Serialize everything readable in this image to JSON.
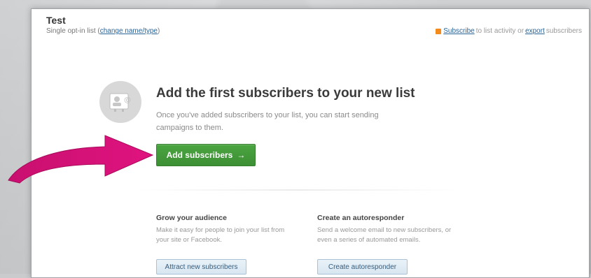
{
  "list": {
    "title": "Test",
    "type_prefix": "Single opt-in list (",
    "change_link": "change name/type",
    "type_suffix": ")"
  },
  "subscribe_bar": {
    "icon": "rss-icon",
    "subscribe_link": "Subscribe",
    "middle_text": " to list activity or ",
    "export_link": "export",
    "end_text": " subscribers"
  },
  "empty_state": {
    "icon": "address-card-icon",
    "headline": "Add the first subscribers to your new list",
    "description": "Once you've added subscribers to your list, you can start sending campaigns to them.",
    "button_label": "Add subscribers",
    "button_arrow": "→"
  },
  "grow": {
    "title": "Grow your audience",
    "description": "Make it easy for people to join your list from your site or Facebook.",
    "button_label": "Attract new subscribers"
  },
  "autoresponder": {
    "title": "Create an autoresponder",
    "description": "Send a welcome email to new subscribers, or even a series of automated emails.",
    "button_label": "Create autoresponder"
  },
  "colors": {
    "accent_green": "#4aa540",
    "pointer_magenta": "#e0137f",
    "link_blue": "#2a6496"
  }
}
